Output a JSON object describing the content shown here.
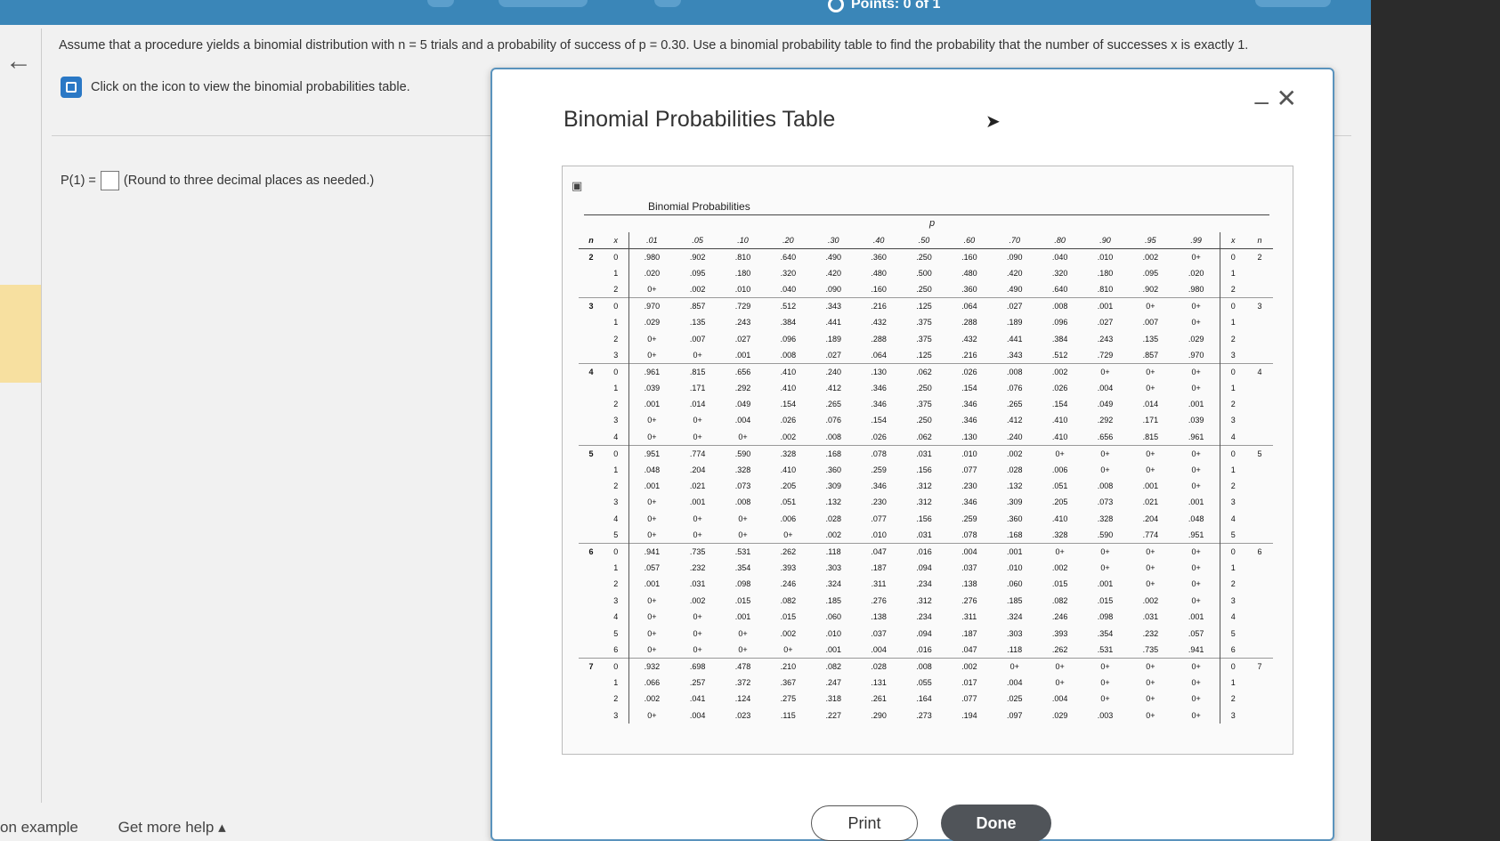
{
  "header": {
    "points": "Points: 0 of 1"
  },
  "question": {
    "text": "Assume that a procedure yields a binomial distribution with n = 5 trials and a probability of success of p = 0.30. Use a binomial probability table to find the probability that the number of successes x is exactly 1.",
    "hint": "Click on the icon to view the binomial probabilities table.",
    "answer_label": "P(1) =",
    "answer_value": "",
    "answer_note": "(Round to three decimal places as needed.)"
  },
  "footer": {
    "example_link": "on example",
    "help_link": "Get more help ▴"
  },
  "modal": {
    "title": "Binomial Probabilities Table",
    "caption": "Binomial Probabilities",
    "p_label": "p",
    "print_label": "Print",
    "done_label": "Done"
  },
  "table": {
    "headers": [
      "n",
      "x",
      ".01",
      ".05",
      ".10",
      ".20",
      ".30",
      ".40",
      ".50",
      ".60",
      ".70",
      ".80",
      ".90",
      ".95",
      ".99",
      "x",
      "n"
    ],
    "rows": [
      [
        "2",
        "0",
        ".980",
        ".902",
        ".810",
        ".640",
        ".490",
        ".360",
        ".250",
        ".160",
        ".090",
        ".040",
        ".010",
        ".002",
        "0+",
        "0",
        "2"
      ],
      [
        "",
        "1",
        ".020",
        ".095",
        ".180",
        ".320",
        ".420",
        ".480",
        ".500",
        ".480",
        ".420",
        ".320",
        ".180",
        ".095",
        ".020",
        "1",
        ""
      ],
      [
        "",
        "2",
        "0+",
        ".002",
        ".010",
        ".040",
        ".090",
        ".160",
        ".250",
        ".360",
        ".490",
        ".640",
        ".810",
        ".902",
        ".980",
        "2",
        ""
      ],
      [
        "3",
        "0",
        ".970",
        ".857",
        ".729",
        ".512",
        ".343",
        ".216",
        ".125",
        ".064",
        ".027",
        ".008",
        ".001",
        "0+",
        "0+",
        "0",
        "3"
      ],
      [
        "",
        "1",
        ".029",
        ".135",
        ".243",
        ".384",
        ".441",
        ".432",
        ".375",
        ".288",
        ".189",
        ".096",
        ".027",
        ".007",
        "0+",
        "1",
        ""
      ],
      [
        "",
        "2",
        "0+",
        ".007",
        ".027",
        ".096",
        ".189",
        ".288",
        ".375",
        ".432",
        ".441",
        ".384",
        ".243",
        ".135",
        ".029",
        "2",
        ""
      ],
      [
        "",
        "3",
        "0+",
        "0+",
        ".001",
        ".008",
        ".027",
        ".064",
        ".125",
        ".216",
        ".343",
        ".512",
        ".729",
        ".857",
        ".970",
        "3",
        ""
      ],
      [
        "4",
        "0",
        ".961",
        ".815",
        ".656",
        ".410",
        ".240",
        ".130",
        ".062",
        ".026",
        ".008",
        ".002",
        "0+",
        "0+",
        "0+",
        "0",
        "4"
      ],
      [
        "",
        "1",
        ".039",
        ".171",
        ".292",
        ".410",
        ".412",
        ".346",
        ".250",
        ".154",
        ".076",
        ".026",
        ".004",
        "0+",
        "0+",
        "1",
        ""
      ],
      [
        "",
        "2",
        ".001",
        ".014",
        ".049",
        ".154",
        ".265",
        ".346",
        ".375",
        ".346",
        ".265",
        ".154",
        ".049",
        ".014",
        ".001",
        "2",
        ""
      ],
      [
        "",
        "3",
        "0+",
        "0+",
        ".004",
        ".026",
        ".076",
        ".154",
        ".250",
        ".346",
        ".412",
        ".410",
        ".292",
        ".171",
        ".039",
        "3",
        ""
      ],
      [
        "",
        "4",
        "0+",
        "0+",
        "0+",
        ".002",
        ".008",
        ".026",
        ".062",
        ".130",
        ".240",
        ".410",
        ".656",
        ".815",
        ".961",
        "4",
        ""
      ],
      [
        "5",
        "0",
        ".951",
        ".774",
        ".590",
        ".328",
        ".168",
        ".078",
        ".031",
        ".010",
        ".002",
        "0+",
        "0+",
        "0+",
        "0+",
        "0",
        "5"
      ],
      [
        "",
        "1",
        ".048",
        ".204",
        ".328",
        ".410",
        ".360",
        ".259",
        ".156",
        ".077",
        ".028",
        ".006",
        "0+",
        "0+",
        "0+",
        "1",
        ""
      ],
      [
        "",
        "2",
        ".001",
        ".021",
        ".073",
        ".205",
        ".309",
        ".346",
        ".312",
        ".230",
        ".132",
        ".051",
        ".008",
        ".001",
        "0+",
        "2",
        ""
      ],
      [
        "",
        "3",
        "0+",
        ".001",
        ".008",
        ".051",
        ".132",
        ".230",
        ".312",
        ".346",
        ".309",
        ".205",
        ".073",
        ".021",
        ".001",
        "3",
        ""
      ],
      [
        "",
        "4",
        "0+",
        "0+",
        "0+",
        ".006",
        ".028",
        ".077",
        ".156",
        ".259",
        ".360",
        ".410",
        ".328",
        ".204",
        ".048",
        "4",
        ""
      ],
      [
        "",
        "5",
        "0+",
        "0+",
        "0+",
        "0+",
        ".002",
        ".010",
        ".031",
        ".078",
        ".168",
        ".328",
        ".590",
        ".774",
        ".951",
        "5",
        ""
      ],
      [
        "6",
        "0",
        ".941",
        ".735",
        ".531",
        ".262",
        ".118",
        ".047",
        ".016",
        ".004",
        ".001",
        "0+",
        "0+",
        "0+",
        "0+",
        "0",
        "6"
      ],
      [
        "",
        "1",
        ".057",
        ".232",
        ".354",
        ".393",
        ".303",
        ".187",
        ".094",
        ".037",
        ".010",
        ".002",
        "0+",
        "0+",
        "0+",
        "1",
        ""
      ],
      [
        "",
        "2",
        ".001",
        ".031",
        ".098",
        ".246",
        ".324",
        ".311",
        ".234",
        ".138",
        ".060",
        ".015",
        ".001",
        "0+",
        "0+",
        "2",
        ""
      ],
      [
        "",
        "3",
        "0+",
        ".002",
        ".015",
        ".082",
        ".185",
        ".276",
        ".312",
        ".276",
        ".185",
        ".082",
        ".015",
        ".002",
        "0+",
        "3",
        ""
      ],
      [
        "",
        "4",
        "0+",
        "0+",
        ".001",
        ".015",
        ".060",
        ".138",
        ".234",
        ".311",
        ".324",
        ".246",
        ".098",
        ".031",
        ".001",
        "4",
        ""
      ],
      [
        "",
        "5",
        "0+",
        "0+",
        "0+",
        ".002",
        ".010",
        ".037",
        ".094",
        ".187",
        ".303",
        ".393",
        ".354",
        ".232",
        ".057",
        "5",
        ""
      ],
      [
        "",
        "6",
        "0+",
        "0+",
        "0+",
        "0+",
        ".001",
        ".004",
        ".016",
        ".047",
        ".118",
        ".262",
        ".531",
        ".735",
        ".941",
        "6",
        ""
      ],
      [
        "7",
        "0",
        ".932",
        ".698",
        ".478",
        ".210",
        ".082",
        ".028",
        ".008",
        ".002",
        "0+",
        "0+",
        "0+",
        "0+",
        "0+",
        "0",
        "7"
      ],
      [
        "",
        "1",
        ".066",
        ".257",
        ".372",
        ".367",
        ".247",
        ".131",
        ".055",
        ".017",
        ".004",
        "0+",
        "0+",
        "0+",
        "0+",
        "1",
        ""
      ],
      [
        "",
        "2",
        ".002",
        ".041",
        ".124",
        ".275",
        ".318",
        ".261",
        ".164",
        ".077",
        ".025",
        ".004",
        "0+",
        "0+",
        "0+",
        "2",
        ""
      ],
      [
        "",
        "3",
        "0+",
        ".004",
        ".023",
        ".115",
        ".227",
        ".290",
        ".273",
        ".194",
        ".097",
        ".029",
        ".003",
        "0+",
        "0+",
        "3",
        ""
      ]
    ]
  },
  "colors": {
    "topbar": "#3a86b8",
    "modal_border": "#5a93bd",
    "done_button": "#505459",
    "hint_icon": "#2a78c5"
  }
}
